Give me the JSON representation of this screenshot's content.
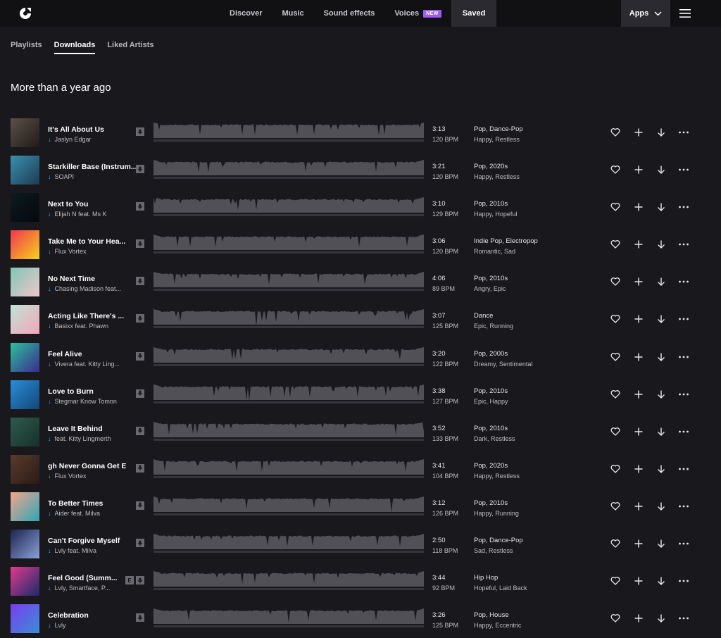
{
  "nav": {
    "links": [
      "Discover",
      "Music",
      "Sound effects",
      "Voices",
      "Saved"
    ],
    "new_badge": "NEW",
    "apps_label": "Apps"
  },
  "subtabs": [
    "Playlists",
    "Downloads",
    "Liked Artists"
  ],
  "section_title": "More than a year ago",
  "tracks": [
    {
      "title": "It's All About Us",
      "artist": "Jaslyn Edgar",
      "duration": "3:13",
      "bpm": "120 BPM",
      "genres": "Pop, Dance-Pop",
      "moods": "Happy, Restless",
      "explicit": "",
      "cover": [
        "#5b5148",
        "#201a17"
      ]
    },
    {
      "title": "Starkiller Base (Instrum...",
      "artist": "SOAPI",
      "duration": "3:21",
      "bpm": "120 BPM",
      "genres": "Pop, 2020s",
      "moods": "Happy, Restless",
      "explicit": "",
      "cover": [
        "#3a8fb0",
        "#1c3c54"
      ]
    },
    {
      "title": "Next to You",
      "artist": "Elijah N feat. Ms K",
      "duration": "3:10",
      "bpm": "129 BPM",
      "genres": "Pop, 2010s",
      "moods": "Happy, Hopeful",
      "explicit": "",
      "cover": [
        "#0d1a22",
        "#06090c"
      ]
    },
    {
      "title": "Take Me to Your Hea...",
      "artist": "Flux Vortex",
      "duration": "3:06",
      "bpm": "120 BPM",
      "genres": "Indie Pop, Electropop",
      "moods": "Romantic, Sad",
      "explicit": "",
      "cover": [
        "#f0364f",
        "#f6d21c"
      ]
    },
    {
      "title": "No Next Time",
      "artist": "Chasing Madison feat...",
      "duration": "4:06",
      "bpm": "89 BPM",
      "genres": "Pop, 2010s",
      "moods": "Angry, Epic",
      "explicit": "",
      "cover": [
        "#7ec6b3",
        "#f0c6cc"
      ]
    },
    {
      "title": "Acting Like There's ...",
      "artist": "Basixx feat. Phawn",
      "duration": "3:07",
      "bpm": "125 BPM",
      "genres": "Dance",
      "moods": "Epic, Running",
      "explicit": "",
      "cover": [
        "#bfe3d9",
        "#f3a6b8"
      ]
    },
    {
      "title": "Feel Alive",
      "artist": "Vivera feat. Kitty Ling...",
      "duration": "3:20",
      "bpm": "122 BPM",
      "genres": "Pop, 2000s",
      "moods": "Dreamy, Sentimental",
      "explicit": "",
      "cover": [
        "#2fbf9b",
        "#3a2c8f"
      ]
    },
    {
      "title": "Love to Burn",
      "artist": "Stegmar  Know Tomon",
      "duration": "3:38",
      "bpm": "127 BPM",
      "genres": "Pop, 2010s",
      "moods": "Epic, Happy",
      "explicit": "",
      "cover": [
        "#2a8ed8",
        "#12467a"
      ]
    },
    {
      "title": "Leave It Behind",
      "artist": "feat. Kitty Lingmerth",
      "duration": "3:52",
      "bpm": "133 BPM",
      "genres": "Pop, 2010s",
      "moods": "Dark, Restless",
      "explicit": "",
      "cover": [
        "#2f5b4e",
        "#17302a"
      ]
    },
    {
      "title": "gh   Never Gonna Get E",
      "artist": "Flux Vortex",
      "duration": "3:41",
      "bpm": "104 BPM",
      "genres": "Pop, 2020s",
      "moods": "Happy, Restless",
      "explicit": "",
      "cover": [
        "#5a3b2e",
        "#2a1a14"
      ]
    },
    {
      "title": "To Better Times",
      "artist": "Aider feat. Milva",
      "duration": "3:12",
      "bpm": "126 BPM",
      "genres": "Pop, 2010s",
      "moods": "Happy, Running",
      "explicit": "",
      "cover": [
        "#f5a58b",
        "#2ea6b8"
      ]
    },
    {
      "title": "Can't Forgive Myself",
      "artist": "Lvly feat. Milva",
      "duration": "2:50",
      "bpm": "118 BPM",
      "genres": "Pop, Dance-Pop",
      "moods": "Sad, Restless",
      "explicit": "",
      "cover": [
        "#1b2450",
        "#8aa2d8"
      ]
    },
    {
      "title": "Feel Good (Summ...",
      "artist": "Lvly, Smartface, P...",
      "duration": "3:44",
      "bpm": "92 BPM",
      "genres": "Hip Hop",
      "moods": "Hopeful, Laid Back",
      "explicit": "E",
      "cover": [
        "#e23a8e",
        "#1a2a6a"
      ]
    },
    {
      "title": "Celebration",
      "artist": "Lvly",
      "duration": "3:26",
      "bpm": "125 BPM",
      "genres": "Pop, House",
      "moods": "Happy, Eccentric",
      "explicit": "",
      "cover": [
        "#7a3df0",
        "#3a8fd8"
      ]
    }
  ]
}
